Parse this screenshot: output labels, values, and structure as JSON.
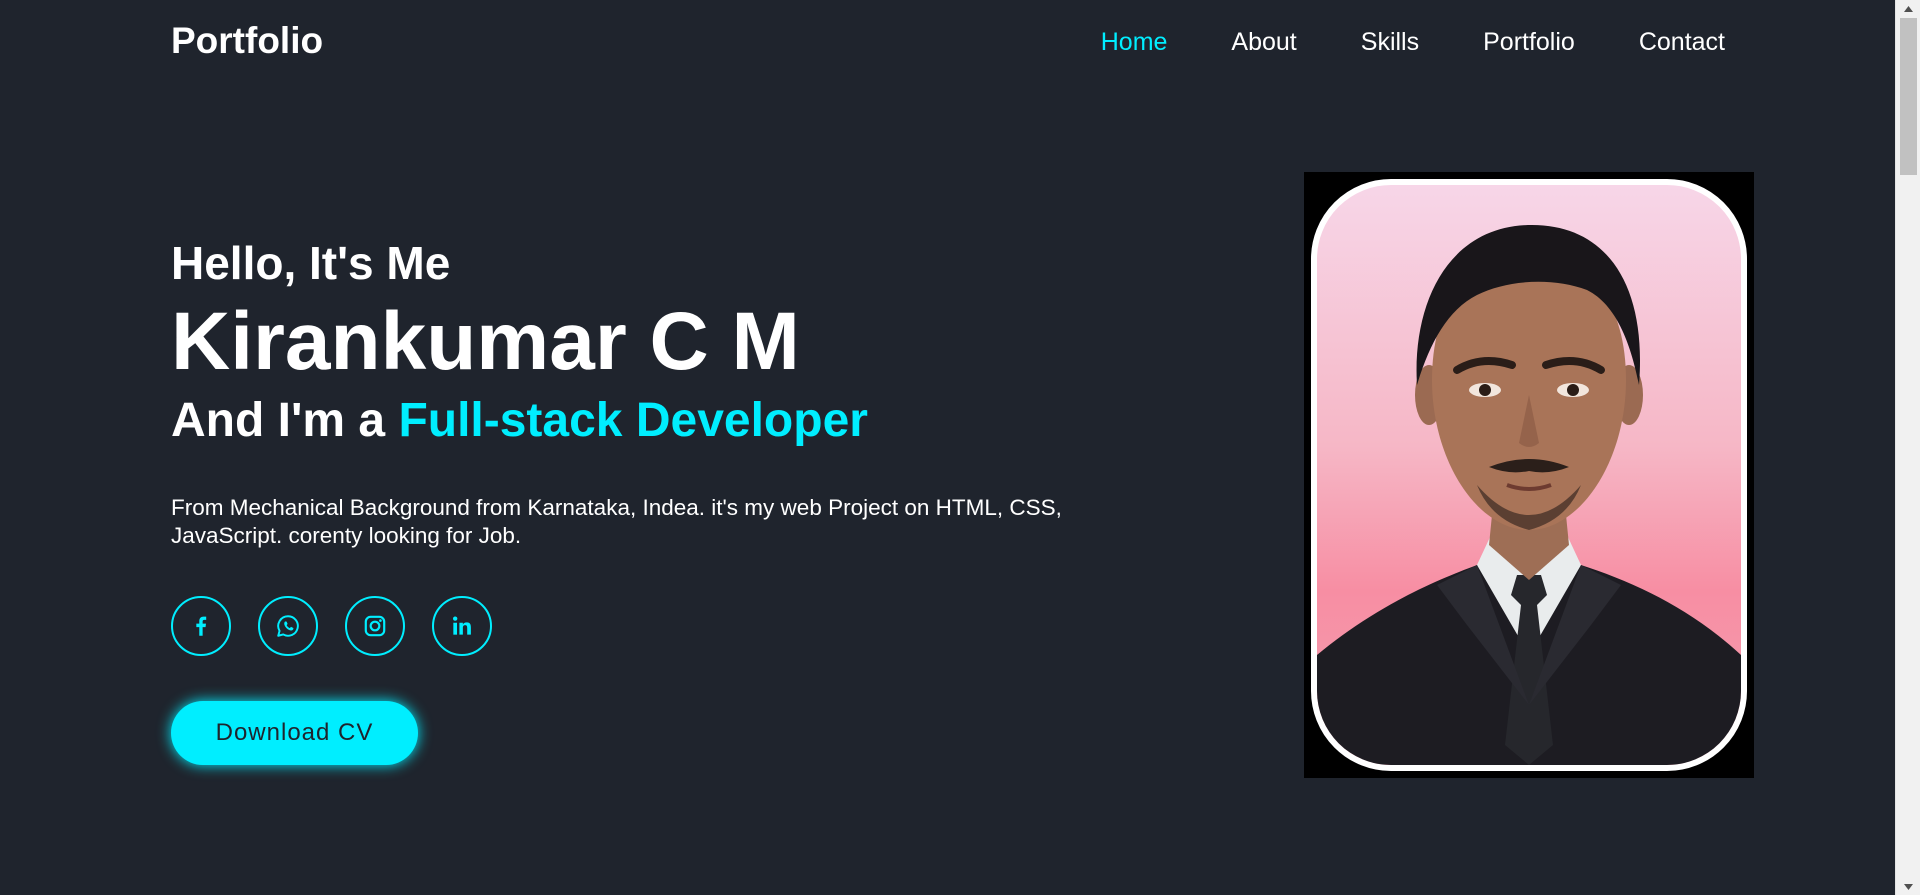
{
  "header": {
    "logo": "Portfolio",
    "nav": [
      {
        "label": "Home",
        "active": true
      },
      {
        "label": "About",
        "active": false
      },
      {
        "label": "Skills",
        "active": false
      },
      {
        "label": "Portfolio",
        "active": false
      },
      {
        "label": "Contact",
        "active": false
      }
    ]
  },
  "hero": {
    "greeting": "Hello, It's Me",
    "name": "Kirankumar C M",
    "role_prefix": "And I'm a ",
    "role": "Full-stack Developer",
    "description": "From Mechanical Background from Karnataka, Indea. it's my web Project on HTML, CSS, JavaScript. corenty looking for Job.",
    "social_icons": [
      "facebook-icon",
      "whatsapp-icon",
      "instagram-icon",
      "linkedin-icon"
    ],
    "cta_label": "Download CV"
  },
  "colors": {
    "background": "#1f242d",
    "accent": "#00eeff",
    "text": "#ffffff"
  }
}
